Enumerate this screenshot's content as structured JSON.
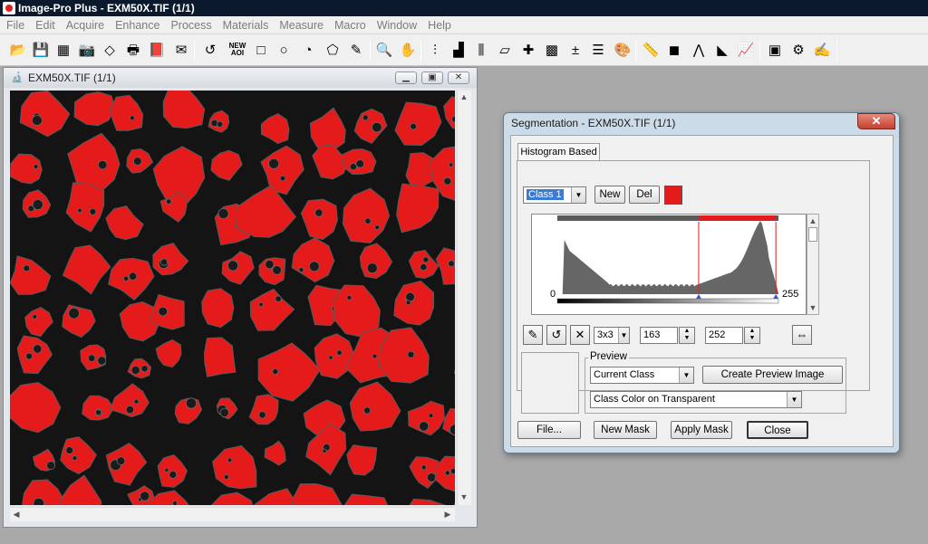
{
  "app": {
    "title": "Image-Pro Plus - EXM50X.TIF (1/1)"
  },
  "menu": [
    "File",
    "Edit",
    "Acquire",
    "Enhance",
    "Process",
    "Materials",
    "Measure",
    "Macro",
    "Window",
    "Help"
  ],
  "toolbar": {
    "new_aoi_label": "NEW\nAOI"
  },
  "image_window": {
    "title": "EXM50X.TIF (1/1)"
  },
  "segmentation": {
    "title": "Segmentation - EXM50X.TIF (1/1)",
    "tab_label": "Histogram Based",
    "class_value": "Class 1",
    "new_label": "New",
    "del_label": "Del",
    "class_color": "#e51b1b",
    "histogram": {
      "min_label": "0",
      "max_label": "255",
      "range_min": 163,
      "range_max": 252
    },
    "neighborhood_value": "3x3",
    "min_value": "163",
    "max_value": "252",
    "preview_group_label": "Preview",
    "preview_mode": "Current Class",
    "create_preview_label": "Create Preview Image",
    "display_mode": "Class Color on Transparent",
    "buttons": {
      "file": "File...",
      "new_mask": "New Mask",
      "apply_mask": "Apply Mask",
      "close": "Close"
    }
  },
  "colors": {
    "class_red": "#e51b1b",
    "titlebar": "#0a1a2c",
    "desktop": "#a9a9a9"
  }
}
